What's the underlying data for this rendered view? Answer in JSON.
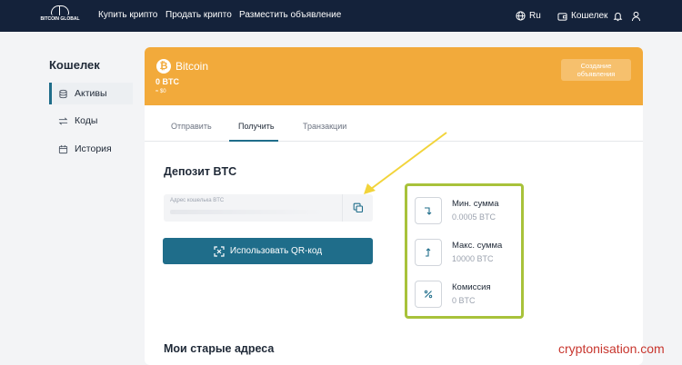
{
  "header": {
    "logo_text": "BITCOIN GLOBAL",
    "nav": [
      "Купить крипто",
      "Продать крипто",
      "Разместить объявление"
    ],
    "language": "Ru",
    "wallet": "Кошелек"
  },
  "sidebar": {
    "title": "Кошелек",
    "items": [
      {
        "label": "Активы",
        "icon": "coins-stack-icon"
      },
      {
        "label": "Коды",
        "icon": "swap-arrows-icon"
      },
      {
        "label": "История",
        "icon": "calendar-icon"
      }
    ]
  },
  "banner": {
    "coin_name": "Bitcoin",
    "balance": "0 BTC",
    "balance_usd": "≈ $0",
    "create_button": "Создание объявления",
    "color": "#f2aa3b"
  },
  "tabs": [
    "Отправить",
    "Получить",
    "Транзакции"
  ],
  "deposit": {
    "title": "Депозит BTC",
    "address_label": "Адрес кошелька BTC",
    "address_value": "",
    "qr_button": "Использовать QR-код"
  },
  "info": [
    {
      "label": "Мин. сумма",
      "value": "0.0005 BTC",
      "icon": "arrow-down-icon"
    },
    {
      "label": "Макс. сумма",
      "value": "10000 BTC",
      "icon": "arrow-up-icon"
    },
    {
      "label": "Комиссия",
      "value": "0 BTC",
      "icon": "percent-icon"
    }
  ],
  "old_addresses_title": "Мои старые адреса",
  "watermark": "cryptonisation.com",
  "colors": {
    "nav_bg": "#14223a",
    "accent": "#1f6d8a",
    "highlight": "#a8c23a",
    "annotation": "#f2d43a"
  }
}
